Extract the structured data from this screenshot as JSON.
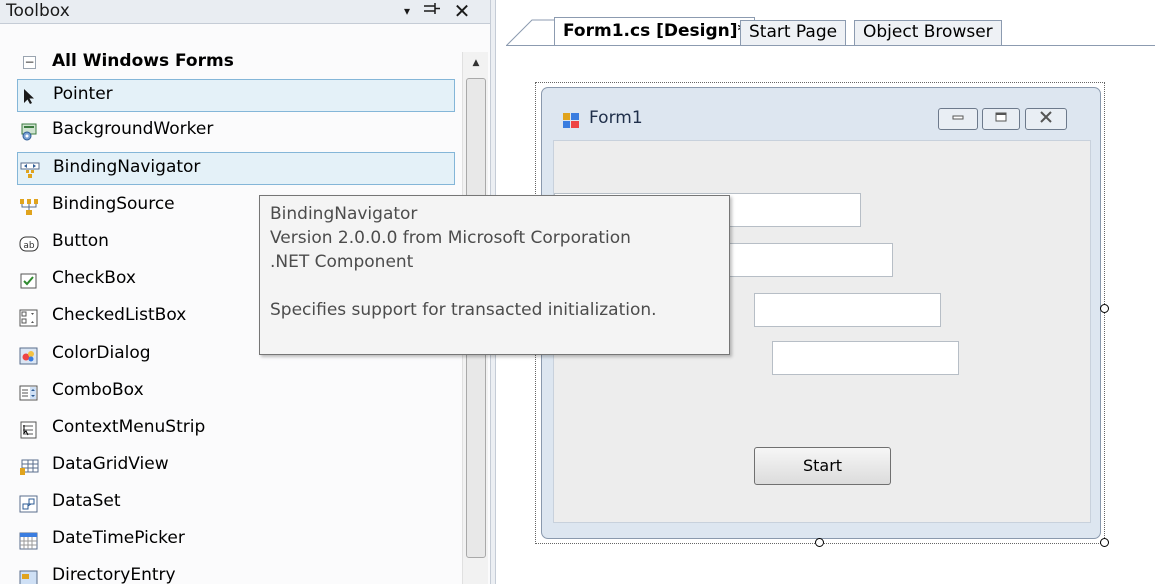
{
  "toolbox": {
    "title": "Toolbox",
    "dropdown_icon": "▾",
    "pin_icon": "⊣",
    "close_icon": "✕",
    "category": {
      "label": "All Windows Forms",
      "toggle": "−"
    },
    "items": [
      {
        "label": "Pointer",
        "icon": "pointer-icon",
        "selected": true
      },
      {
        "label": "BackgroundWorker",
        "icon": "backgroundworker-icon",
        "selected": false
      },
      {
        "label": "BindingNavigator",
        "icon": "bindingnavigator-icon",
        "selected": true
      },
      {
        "label": "BindingSource",
        "icon": "bindingsource-icon",
        "selected": false
      },
      {
        "label": "Button",
        "icon": "button-icon",
        "selected": false
      },
      {
        "label": "CheckBox",
        "icon": "checkbox-icon",
        "selected": false
      },
      {
        "label": "CheckedListBox",
        "icon": "checkedlistbox-icon",
        "selected": false
      },
      {
        "label": "ColorDialog",
        "icon": "colordialog-icon",
        "selected": false
      },
      {
        "label": "ComboBox",
        "icon": "combobox-icon",
        "selected": false
      },
      {
        "label": "ContextMenuStrip",
        "icon": "contextmenustrip-icon",
        "selected": false
      },
      {
        "label": "DataGridView",
        "icon": "datagridview-icon",
        "selected": false
      },
      {
        "label": "DataSet",
        "icon": "dataset-icon",
        "selected": false
      },
      {
        "label": "DateTimePicker",
        "icon": "datetimepicker-icon",
        "selected": false
      },
      {
        "label": "DirectoryEntry",
        "icon": "directoryentry-icon",
        "selected": false
      }
    ]
  },
  "tooltip": {
    "name": "BindingNavigator",
    "version": "Version 2.0.0.0 from Microsoft Corporation",
    "kind": ".NET Component",
    "description": "Specifies support for transacted initialization."
  },
  "tabs": [
    {
      "label": "Form1.cs [Design]*",
      "active": true
    },
    {
      "label": "Start Page",
      "active": false
    },
    {
      "label": "Object Browser",
      "active": false
    }
  ],
  "form": {
    "title": "Form1",
    "start_button": "Start"
  },
  "colors": {
    "selection_bg": "#e4f1f8",
    "selection_border": "#84b6d8",
    "form_frame": "#dde6f0"
  }
}
